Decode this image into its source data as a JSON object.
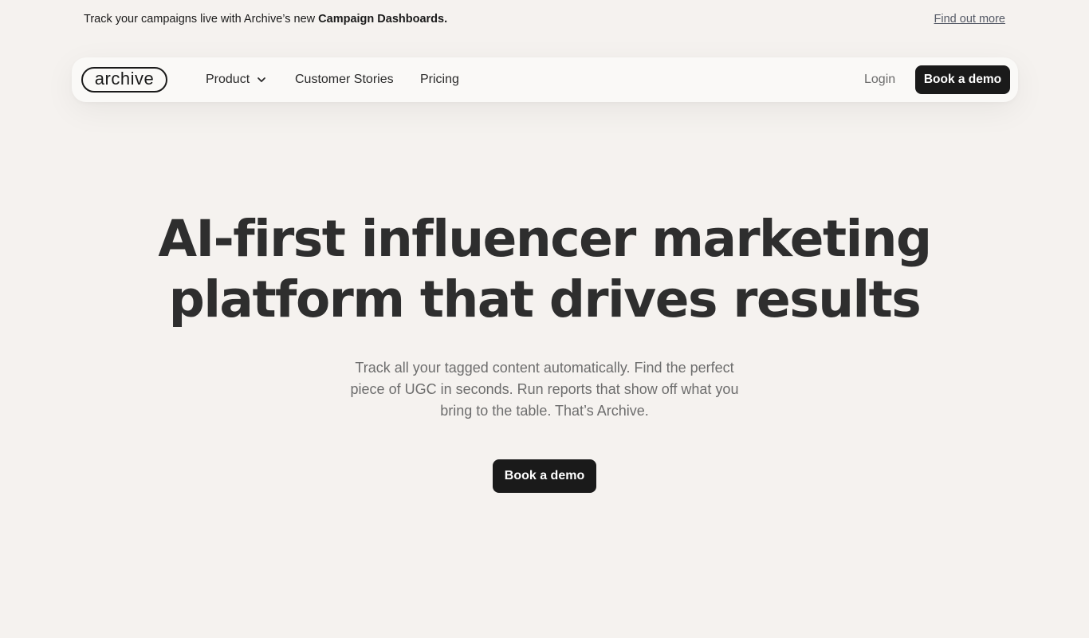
{
  "announcement": {
    "text": "Track your campaigns live with Archive’s new ",
    "highlight": "Campaign  Dashboards.",
    "link": "Find out more"
  },
  "nav": {
    "logo": "archive",
    "items": [
      {
        "label": "Product",
        "icon": "chevron-down-icon"
      },
      {
        "label": "Customer Stories"
      },
      {
        "label": "Pricing"
      }
    ],
    "login": "Login",
    "cta": "Book a demo"
  },
  "hero": {
    "title_line1": "AI-first influencer marketing",
    "title_line2": "platform that drives results",
    "subtitle": "Track all your tagged content automatically. Find the perfect piece of UGC in seconds. Run reports that show off what you bring to the table. That’s Archive.",
    "cta": "Book a demo"
  },
  "colors": {
    "background": "#f5f2ef",
    "nav_background": "#faf9f7",
    "button": "#1a1a1a",
    "heading": "#2e2e2e",
    "subtitle": "#6d6d6d"
  }
}
